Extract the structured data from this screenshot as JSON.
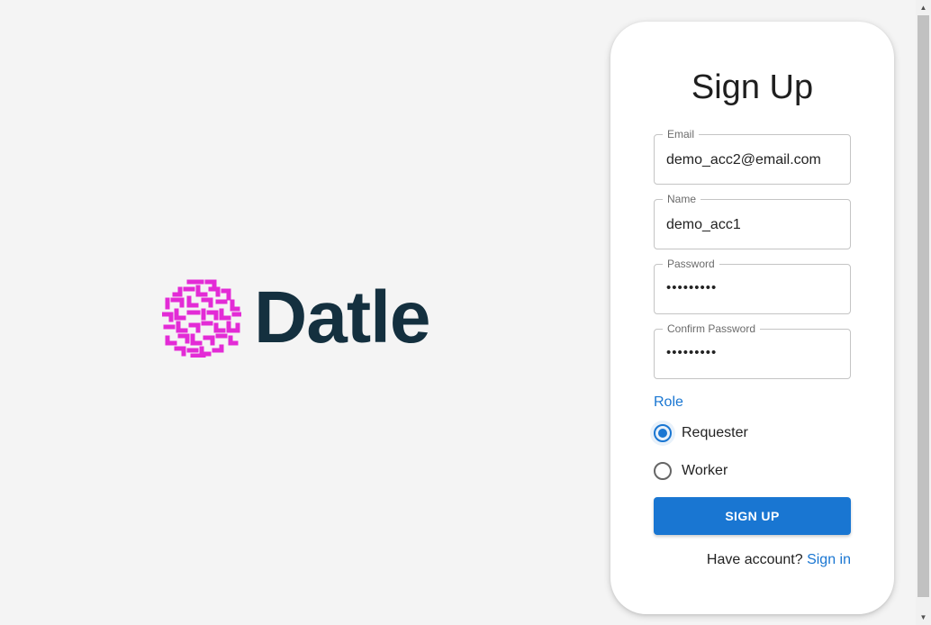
{
  "brand": {
    "name": "Datle",
    "logo_icon": "datle-maze-icon",
    "logo_color": "#e32bd6",
    "text_color": "#14303f"
  },
  "form": {
    "title": "Sign Up",
    "fields": [
      {
        "label": "Email",
        "value": "demo_acc2@email.com",
        "type": "text"
      },
      {
        "label": "Name",
        "value": "demo_acc1",
        "type": "text"
      },
      {
        "label": "Password",
        "value": "•••••••••",
        "type": "password"
      },
      {
        "label": "Confirm Password",
        "value": "•••••••••",
        "type": "password"
      }
    ],
    "role": {
      "label": "Role",
      "options": [
        {
          "label": "Requester",
          "selected": true
        },
        {
          "label": "Worker",
          "selected": false
        }
      ]
    },
    "submit_label": "SIGN UP",
    "footer": {
      "text": "Have account?",
      "link": "Sign in"
    }
  },
  "colors": {
    "accent": "#1976d2",
    "background": "#f4f4f4",
    "card": "#ffffff"
  }
}
